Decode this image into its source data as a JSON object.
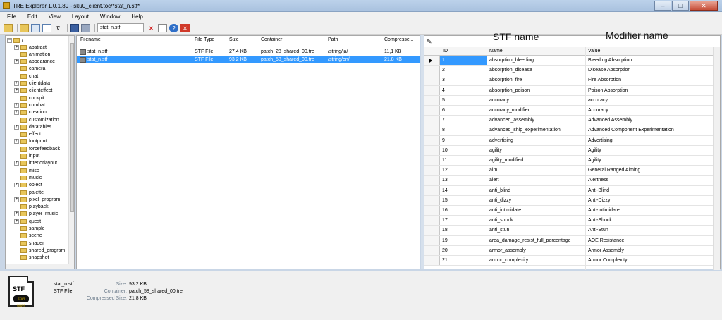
{
  "window": {
    "title": "TRE Explorer 1.0.1.89 - sku0_client.toc/*stat_n.stf*",
    "minimize": "–",
    "maximize": "□",
    "close": "✕"
  },
  "menu": [
    "File",
    "Edit",
    "View",
    "Layout",
    "Window",
    "Help"
  ],
  "toolbar": {
    "search_value": "stat_n.stf",
    "icons": [
      "open-folder-icon",
      "folder-up-icon",
      "view-icon",
      "layout-icon",
      "filter-icon",
      "save-icon",
      "save-all-icon",
      "clear-icon",
      "new-icon",
      "help-icon",
      "exit-icon"
    ]
  },
  "tree": {
    "root": "/",
    "items": [
      {
        "label": "abstract",
        "expand": "+"
      },
      {
        "label": "animation",
        "expand": ""
      },
      {
        "label": "appearance",
        "expand": "+"
      },
      {
        "label": "camera",
        "expand": ""
      },
      {
        "label": "chat",
        "expand": ""
      },
      {
        "label": "clientdata",
        "expand": "+"
      },
      {
        "label": "clienteffect",
        "expand": "+"
      },
      {
        "label": "cockpit",
        "expand": ""
      },
      {
        "label": "combat",
        "expand": "+"
      },
      {
        "label": "creation",
        "expand": "+"
      },
      {
        "label": "customization",
        "expand": ""
      },
      {
        "label": "datatables",
        "expand": "+"
      },
      {
        "label": "effect",
        "expand": ""
      },
      {
        "label": "footprint",
        "expand": "+"
      },
      {
        "label": "forcefeedback",
        "expand": ""
      },
      {
        "label": "input",
        "expand": ""
      },
      {
        "label": "interiorlayout",
        "expand": "+"
      },
      {
        "label": "misc",
        "expand": ""
      },
      {
        "label": "music",
        "expand": ""
      },
      {
        "label": "object",
        "expand": "+"
      },
      {
        "label": "palette",
        "expand": ""
      },
      {
        "label": "pixel_program",
        "expand": "+"
      },
      {
        "label": "playback",
        "expand": ""
      },
      {
        "label": "player_music",
        "expand": "+"
      },
      {
        "label": "quest",
        "expand": "+"
      },
      {
        "label": "sample",
        "expand": ""
      },
      {
        "label": "scene",
        "expand": ""
      },
      {
        "label": "shader",
        "expand": ""
      },
      {
        "label": "shared_program",
        "expand": ""
      },
      {
        "label": "snapshot",
        "expand": ""
      }
    ]
  },
  "files": {
    "headers": [
      "Filename",
      "File Type",
      "Size",
      "Container",
      "Path",
      "Compresse..."
    ],
    "rows": [
      {
        "filename": "stat_n.stf",
        "type": "STF File",
        "size": "27,4 KB",
        "container": "patch_28_shared_00.tre",
        "path": "/string/ja/",
        "compressed": "11,1 KB",
        "selected": false
      },
      {
        "filename": "stat_n.stf",
        "type": "STF File",
        "size": "93,2 KB",
        "container": "patch_58_shared_00.tre",
        "path": "/string/en/",
        "compressed": "21,8 KB",
        "selected": true
      }
    ]
  },
  "stf": {
    "annotation_name": "STF name",
    "annotation_modifier": "Modifier name",
    "headers": [
      "ID",
      "Name",
      "Value"
    ],
    "rows": [
      {
        "id": "1",
        "name": "absorption_bleeding",
        "value": "Bleeding Absorption"
      },
      {
        "id": "2",
        "name": "absorption_disease",
        "value": "Disease Absorption"
      },
      {
        "id": "3",
        "name": "absorption_fire",
        "value": "Fire Absorption"
      },
      {
        "id": "4",
        "name": "absorption_poison",
        "value": "Poison Absorption"
      },
      {
        "id": "5",
        "name": "accuracy",
        "value": "accuracy"
      },
      {
        "id": "6",
        "name": "accuracy_modifier",
        "value": "Accuracy"
      },
      {
        "id": "7",
        "name": "advanced_assembly",
        "value": "Advanced Assembly"
      },
      {
        "id": "8",
        "name": "advanced_ship_experimentation",
        "value": "Advanced Component Experimentation"
      },
      {
        "id": "9",
        "name": "advertising",
        "value": "Advertising"
      },
      {
        "id": "10",
        "name": "agility",
        "value": "Agility"
      },
      {
        "id": "11",
        "name": "agility_modified",
        "value": "Agility"
      },
      {
        "id": "12",
        "name": "aim",
        "value": "General Ranged Aiming"
      },
      {
        "id": "13",
        "name": "alert",
        "value": "Alertness"
      },
      {
        "id": "14",
        "name": "anti_blind",
        "value": "Anti-Blind"
      },
      {
        "id": "15",
        "name": "anti_dizzy",
        "value": "Anti-Dizzy"
      },
      {
        "id": "16",
        "name": "anti_intimidate",
        "value": "Anti-Intimidate"
      },
      {
        "id": "17",
        "name": "anti_shock",
        "value": "Anti-Shock"
      },
      {
        "id": "18",
        "name": "anti_stun",
        "value": "Anti-Stun"
      },
      {
        "id": "19",
        "name": "area_damage_resist_full_percentage",
        "value": "AOE Resistance"
      },
      {
        "id": "20",
        "name": "armor_assembly",
        "value": "Armor Assembly"
      },
      {
        "id": "21",
        "name": "armor_complexity",
        "value": "Armor Complexity"
      }
    ]
  },
  "info": {
    "icon_ext": "STF",
    "icon_logo": "STAR WARS",
    "filename": "stat_n.stf",
    "filetype": "STF File",
    "size_label": "Size:",
    "size_value": "93,2 KB",
    "container_label": "Container:",
    "container_value": "patch_58_shared_00.tre",
    "compressed_label": "Compressed Size:",
    "compressed_value": "21,8 KB"
  }
}
